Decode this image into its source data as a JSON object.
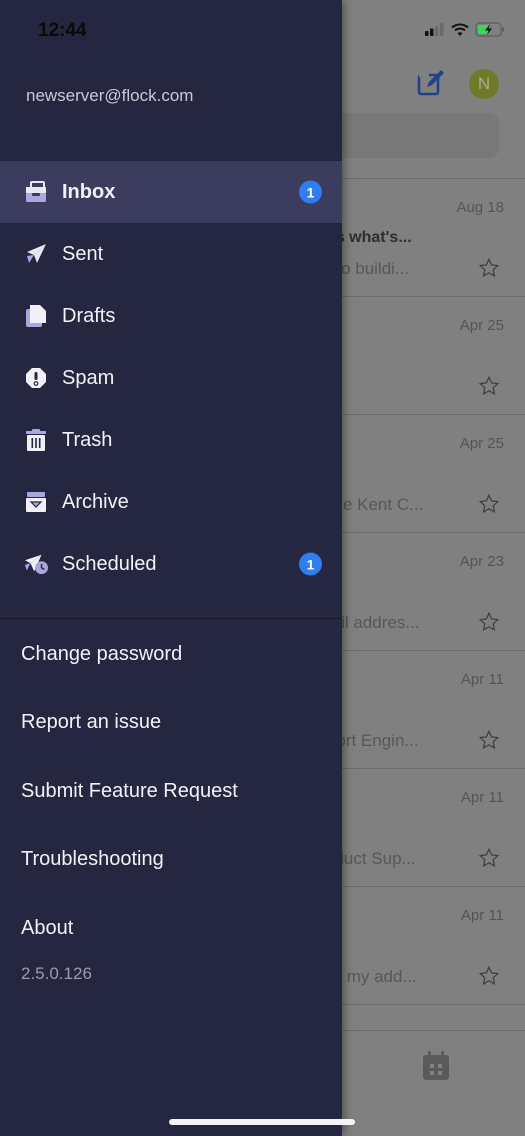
{
  "status_bar": {
    "time": "12:44"
  },
  "drawer": {
    "account_email": "newserver@flock.com",
    "folders": [
      {
        "label": "Inbox",
        "icon": "inbox-icon",
        "badge": "1",
        "active": true
      },
      {
        "label": "Sent",
        "icon": "paper-plane-icon",
        "badge": null,
        "active": false
      },
      {
        "label": "Drafts",
        "icon": "drafts-icon",
        "badge": null,
        "active": false
      },
      {
        "label": "Spam",
        "icon": "spam-icon",
        "badge": null,
        "active": false
      },
      {
        "label": "Trash",
        "icon": "trash-icon",
        "badge": null,
        "active": false
      },
      {
        "label": "Archive",
        "icon": "archive-icon",
        "badge": null,
        "active": false
      },
      {
        "label": "Scheduled",
        "icon": "scheduled-icon",
        "badge": "1",
        "active": false
      }
    ],
    "links": [
      {
        "label": "Change password"
      },
      {
        "label": "Report an issue"
      },
      {
        "label": "Submit Feature Request"
      },
      {
        "label": "Troubleshooting"
      },
      {
        "label": "About"
      }
    ],
    "version": "2.5.0.126"
  },
  "background": {
    "avatar_initial": "N",
    "emails": [
      {
        "date": "Aug 18",
        "subject": "ere's what's...",
        "preview": "ted to buildi..."
      },
      {
        "date": "Apr 25",
        "subject": "",
        "preview": ""
      },
      {
        "date": "Apr 25",
        "subject": "",
        "preview": "Hythe Kent C..."
      },
      {
        "date": "Apr 23",
        "subject": "",
        "preview": "email addres..."
      },
      {
        "date": "Apr 11",
        "subject": "",
        "preview": "upport Engin..."
      },
      {
        "date": "Apr 11",
        "subject": "",
        "preview": "Product Sup..."
      },
      {
        "date": "Apr 11",
        "subject": "",
        "preview": "from my add..."
      }
    ]
  },
  "colors": {
    "drawer_bg": "#252740",
    "active_bg": "#3b3c5e",
    "badge": "#2f7ef0",
    "icon_accent": "#a9a6e0",
    "avatar": "#6f7a2a"
  }
}
